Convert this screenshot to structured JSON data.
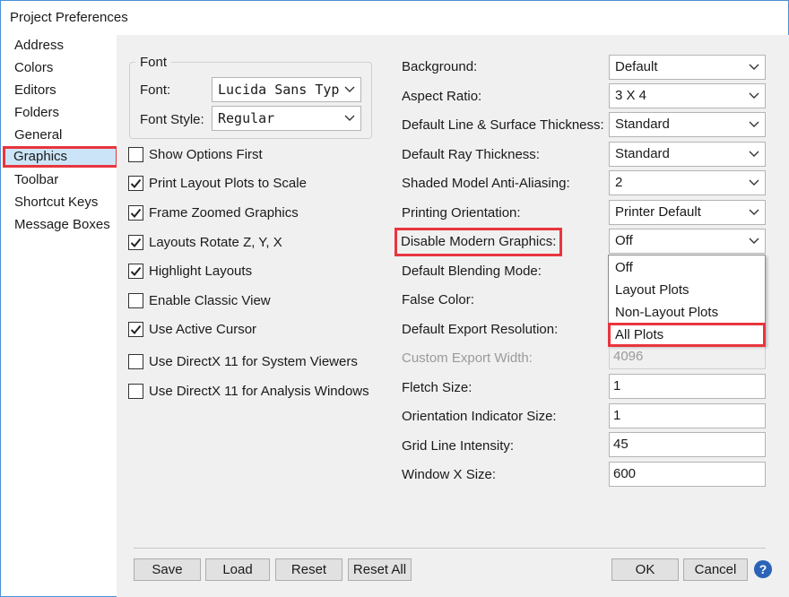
{
  "window": {
    "title": "Project Preferences"
  },
  "sidebar": {
    "items": [
      {
        "label": "Address"
      },
      {
        "label": "Colors"
      },
      {
        "label": "Editors"
      },
      {
        "label": "Folders"
      },
      {
        "label": "General"
      },
      {
        "label": "Graphics",
        "selected": true
      },
      {
        "label": "Toolbar"
      },
      {
        "label": "Shortcut Keys"
      },
      {
        "label": "Message Boxes"
      }
    ]
  },
  "font_group": {
    "legend": "Font",
    "font_label": "Font:",
    "font_value": "Lucida Sans Typewriter",
    "style_label": "Font Style:",
    "style_value": "Regular"
  },
  "checkboxes": [
    {
      "label": "Show Options First",
      "checked": false
    },
    {
      "label": "Print Layout Plots to Scale",
      "checked": true
    },
    {
      "label": "Frame Zoomed Graphics",
      "checked": true
    },
    {
      "label": "Layouts Rotate Z, Y, X",
      "checked": true
    },
    {
      "label": "Highlight Layouts",
      "checked": true
    },
    {
      "label": "Enable Classic View",
      "checked": false
    },
    {
      "label": "Use Active Cursor",
      "checked": true
    },
    {
      "label": "Use DirectX 11 for System Viewers",
      "checked": false
    },
    {
      "label": "Use DirectX 11 for Analysis Windows",
      "checked": false
    }
  ],
  "settings": {
    "background": {
      "label": "Background:",
      "value": "Default"
    },
    "aspect_ratio": {
      "label": "Aspect Ratio:",
      "value": "3 X 4"
    },
    "line_thickness": {
      "label": "Default Line & Surface Thickness:",
      "value": "Standard"
    },
    "ray_thickness": {
      "label": "Default Ray Thickness:",
      "value": "Standard"
    },
    "anti_aliasing": {
      "label": "Shaded Model Anti-Aliasing:",
      "value": "2"
    },
    "printing_orientation": {
      "label": "Printing Orientation:",
      "value": "Printer Default"
    },
    "disable_modern": {
      "label": "Disable Modern Graphics:",
      "value": "Off"
    },
    "blending_mode": {
      "label": "Default Blending Mode:"
    },
    "false_color": {
      "label": "False Color:"
    },
    "export_resolution": {
      "label": "Default Export Resolution:"
    },
    "custom_export_width": {
      "label": "Custom Export Width:",
      "value": "4096"
    },
    "fletch_size": {
      "label": "Fletch Size:",
      "value": "1"
    },
    "orientation_indicator": {
      "label": "Orientation Indicator Size:",
      "value": "1"
    },
    "grid_intensity": {
      "label": "Grid Line Intensity:",
      "value": "45"
    },
    "window_x_size": {
      "label": "Window X Size:",
      "value": "600"
    }
  },
  "dropdown": {
    "options": [
      "Off",
      "Layout Plots",
      "Non-Layout Plots",
      "All Plots"
    ],
    "highlighted": "All Plots"
  },
  "buttons": {
    "save": "Save",
    "load": "Load",
    "reset": "Reset",
    "reset_all": "Reset All",
    "ok": "OK",
    "cancel": "Cancel",
    "help": "?"
  },
  "colors": {
    "highlight_outline": "#e8353e",
    "selected_bg": "#cce4f7",
    "help_icon": "#2a63b8"
  }
}
